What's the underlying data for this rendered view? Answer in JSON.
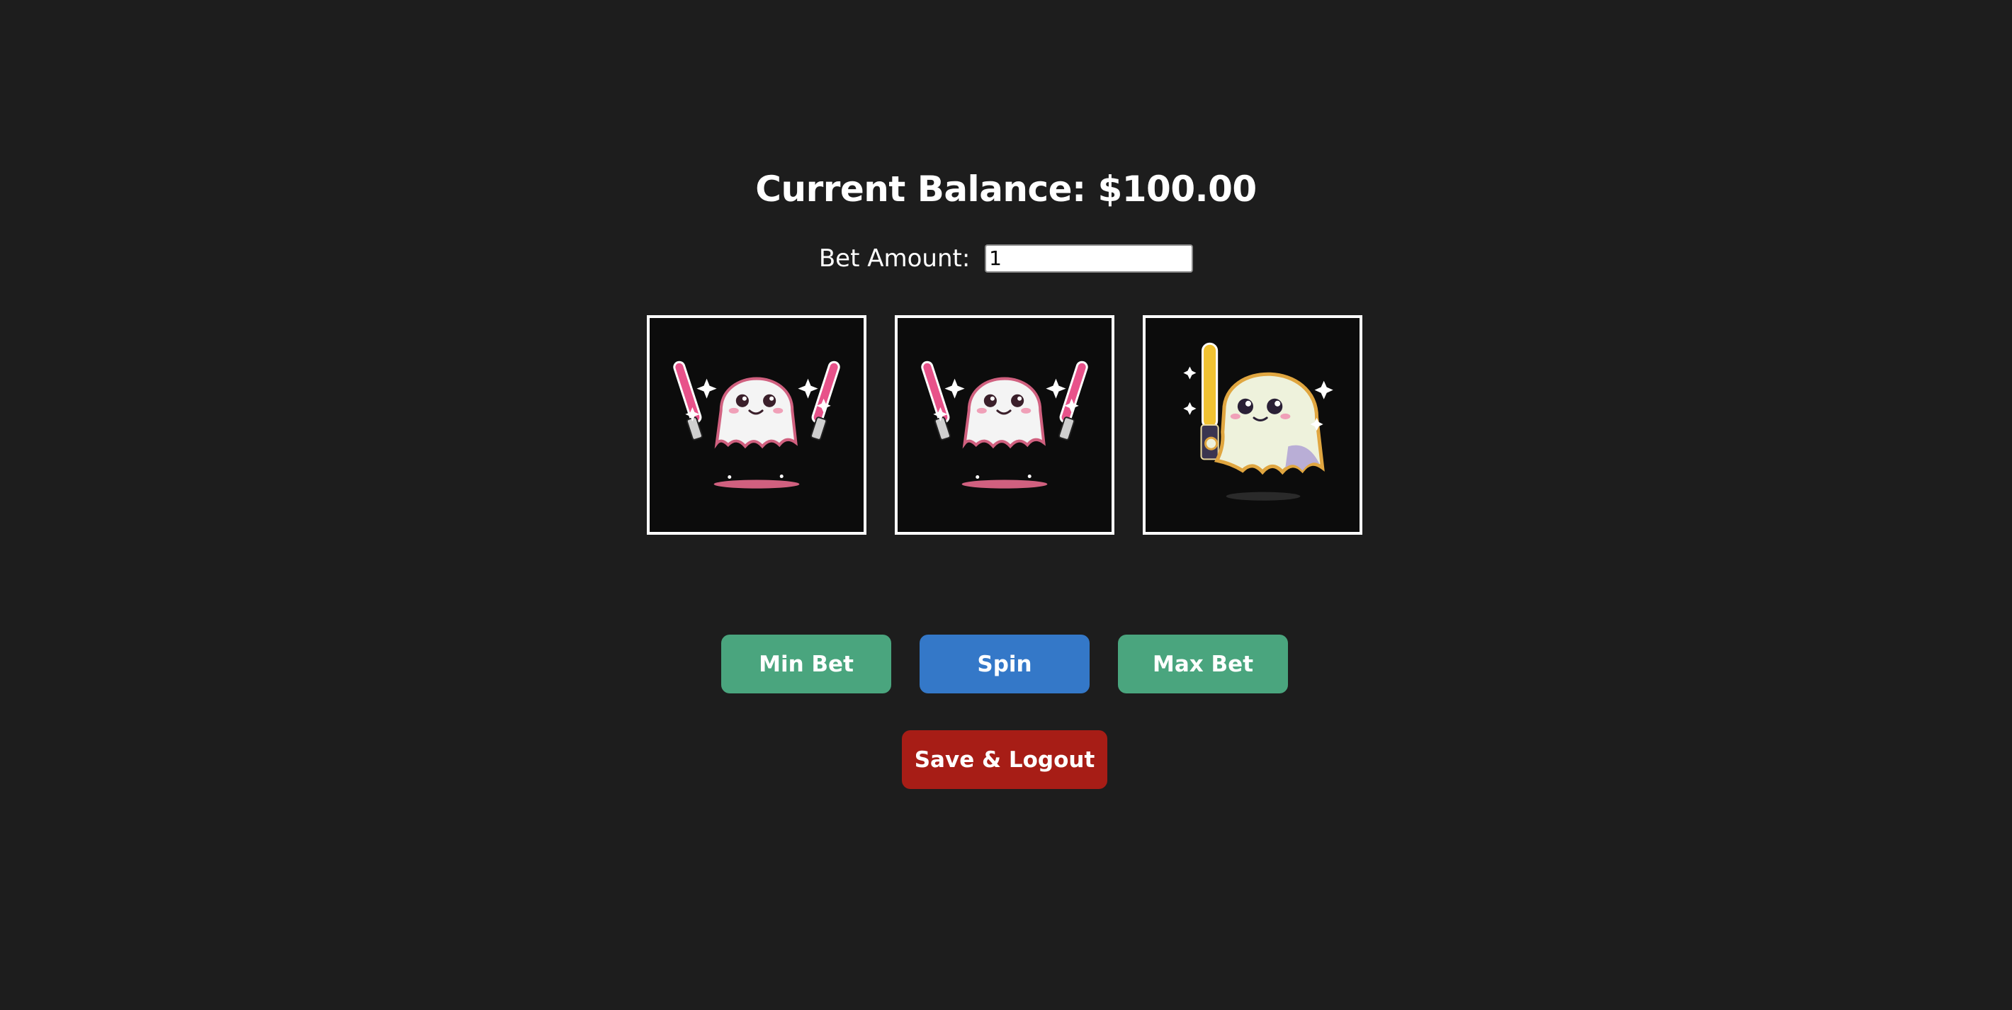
{
  "header": {
    "balance_text": "Current Balance: $100.00"
  },
  "bet": {
    "label": "Bet Amount:",
    "value": "1"
  },
  "reels": [
    {
      "symbol": "pink-ghost-dual-lightsabers-icon"
    },
    {
      "symbol": "pink-ghost-dual-lightsabers-icon"
    },
    {
      "symbol": "yellow-ghost-lightsaber-icon"
    }
  ],
  "controls": {
    "min_bet_label": "Min Bet",
    "spin_label": "Spin",
    "max_bet_label": "Max Bet",
    "save_logout_label": "Save & Logout"
  },
  "colors": {
    "background": "#1d1d1d",
    "min_max_button": "#4aa57e",
    "spin_button": "#3478c8",
    "logout_button": "#a71d16",
    "reel_border": "#ffffff"
  }
}
